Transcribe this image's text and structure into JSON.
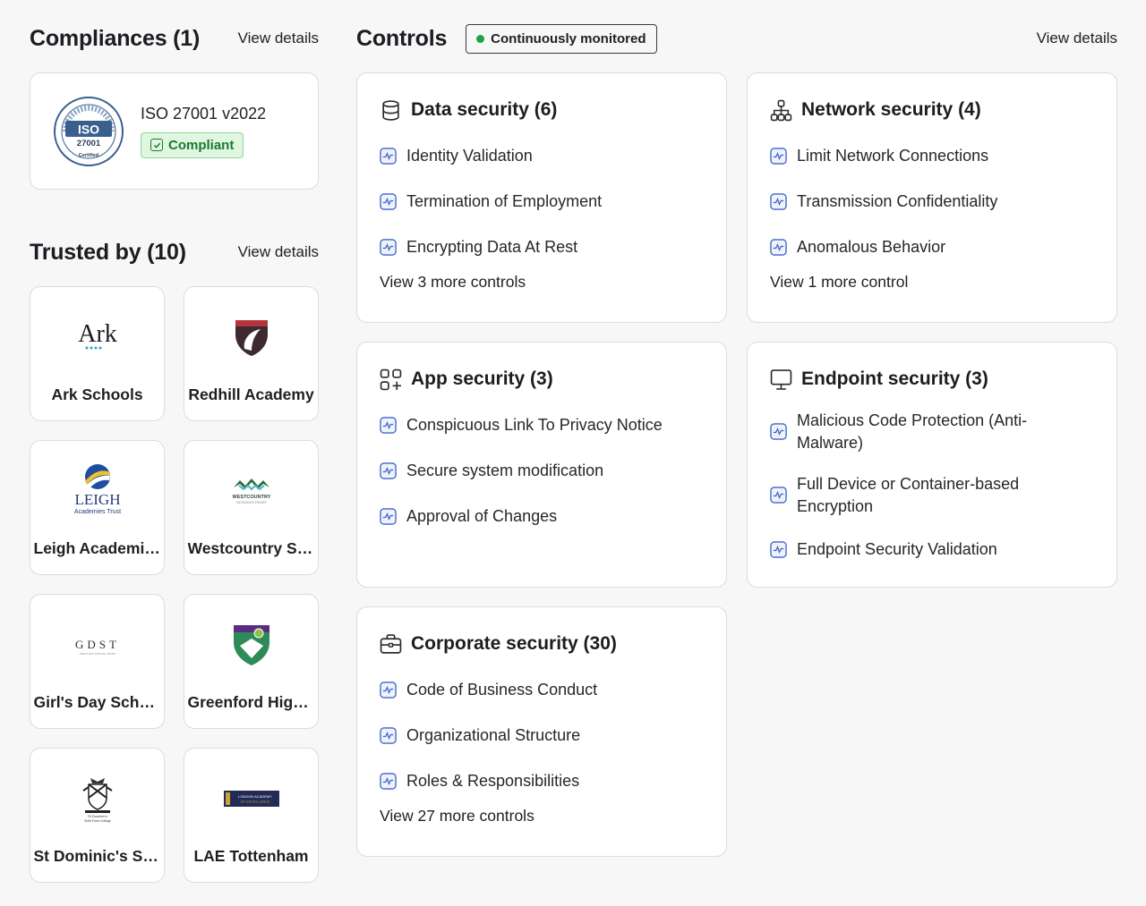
{
  "compliances": {
    "title": "Compliances (1)",
    "view_details": "View details",
    "items": [
      {
        "name": "ISO 27001 v2022",
        "status": "Compliant",
        "badge_text": "ISO",
        "badge_number": "27001",
        "badge_ring_text": "Information Security Management System",
        "badge_certified": "Certified"
      }
    ]
  },
  "trusted": {
    "title": "Trusted by (10)",
    "view_details": "View details",
    "items": [
      {
        "name": "Ark Schools",
        "logo_text": "Ark"
      },
      {
        "name": "Redhill Academy",
        "logo_text": ""
      },
      {
        "name": "Leigh Academies Trust",
        "logo_text": "LEIGH",
        "logo_sub": "Academies Trust"
      },
      {
        "name": "Westcountry Schools Trust",
        "logo_text": "WESTCOUNTRY",
        "logo_sub": "SCHOOLS TRUST"
      },
      {
        "name": "Girl's Day School Trust",
        "logo_text": "GDST",
        "logo_sub": "GIRLS' DAY SCHOOL TRUST"
      },
      {
        "name": "Greenford High School",
        "logo_text": ""
      },
      {
        "name": "St Dominic's Sixth Form College",
        "logo_text": "St Dominic's",
        "logo_sub": "Sixth Form College"
      },
      {
        "name": "LAE Tottenham",
        "logo_text": "LONDON ACADEMY",
        "logo_sub": "OF EXCELLENCE"
      }
    ]
  },
  "controls": {
    "title": "Controls",
    "monitor_badge": "Continuously monitored",
    "view_details": "View details",
    "colors": {
      "monitor_dot": "#1fa341",
      "compliant_green": "#1a7a30",
      "pulse_blue": "#3d63c9"
    },
    "groups": [
      {
        "title": "Data security (6)",
        "icon": "database-icon",
        "items": [
          "Identity Validation",
          "Termination of Employment",
          "Encrypting Data At Rest"
        ],
        "more": "View 3 more controls"
      },
      {
        "title": "Network security (4)",
        "icon": "network-icon",
        "items": [
          "Limit Network Connections",
          "Transmission Confidentiality",
          "Anomalous Behavior"
        ],
        "more": "View 1 more control"
      },
      {
        "title": "App security (3)",
        "icon": "apps-icon",
        "items": [
          "Conspicuous Link To Privacy Notice",
          "Secure system modification",
          "Approval of Changes"
        ],
        "more": ""
      },
      {
        "title": "Endpoint security (3)",
        "icon": "monitor-icon",
        "items": [
          "Malicious Code Protection (Anti-Malware)",
          "Full Device or Container-based Encryption",
          "Endpoint Security Validation"
        ],
        "more": ""
      },
      {
        "title": "Corporate security (30)",
        "icon": "briefcase-icon",
        "items": [
          "Code of Business Conduct",
          "Organizational Structure",
          "Roles & Responsibilities"
        ],
        "more": "View 27 more controls"
      }
    ]
  }
}
